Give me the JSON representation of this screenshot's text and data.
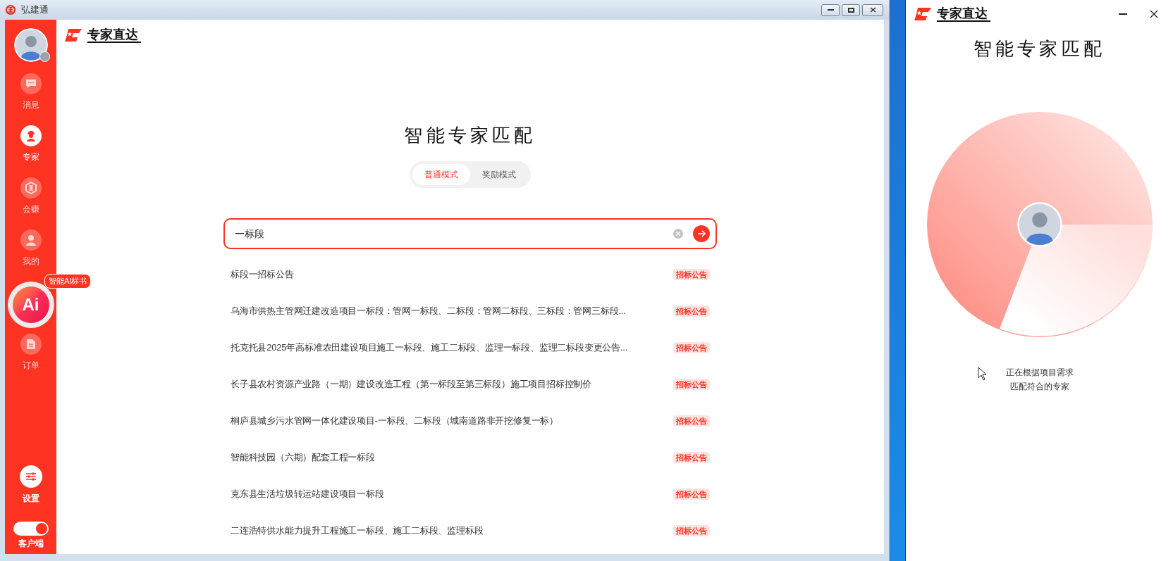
{
  "window": {
    "title": "弘建通"
  },
  "sidebar": {
    "items": [
      {
        "kind": "nav",
        "label": "消息",
        "selected": false
      },
      {
        "kind": "nav",
        "label": "专家",
        "selected": true
      },
      {
        "kind": "nav",
        "label": "会赚",
        "selected": false
      },
      {
        "kind": "nav",
        "label": "我的",
        "selected": false
      },
      {
        "kind": "ai",
        "label": "Ai",
        "badge": "智能AI标书"
      },
      {
        "kind": "nav",
        "label": "订单",
        "selected": false
      }
    ],
    "settings": {
      "label": "设置"
    },
    "client_toggle": {
      "label": "客户端",
      "on": true
    }
  },
  "header": {
    "logo_text": "专家直达"
  },
  "main": {
    "title": "智能专家匹配",
    "modes": [
      {
        "label": "普通模式",
        "selected": true
      },
      {
        "label": "奖励模式",
        "selected": false
      }
    ],
    "search": {
      "value": "一标段"
    },
    "results": [
      {
        "title": "标段一招标公告",
        "tag": "招标公告"
      },
      {
        "title": "乌海市供热主管网迁建改造项目一标段：管网一标段、二标段：管网二标段、三标段：管网三标段...",
        "tag": "招标公告"
      },
      {
        "title": "托克托县2025年高标准农田建设项目施工一标段、施工二标段、监理一标段、监理二标段变更公告...",
        "tag": "招标公告"
      },
      {
        "title": "长子县农村资源产业路（一期）建设改造工程（第一标段至第三标段）施工项目招标控制价",
        "tag": "招标公告"
      },
      {
        "title": "桐庐县城乡污水管网一体化建设项目-一标段、二标段（城南道路非开挖修复一标）",
        "tag": "招标公告"
      },
      {
        "title": "智能科技园（六期）配套工程一标段",
        "tag": "招标公告"
      },
      {
        "title": "克东县生活垃圾转运站建设项目一标段",
        "tag": "招标公告"
      },
      {
        "title": "二连浩特供水能力提升工程施工一标段、施工二标段、监理标段",
        "tag": "招标公告"
      }
    ]
  },
  "side_panel": {
    "logo_text": "专家直达",
    "title": "智能专家匹配",
    "status": [
      "正在根据项目需求",
      "匹配符合的专家"
    ]
  }
}
